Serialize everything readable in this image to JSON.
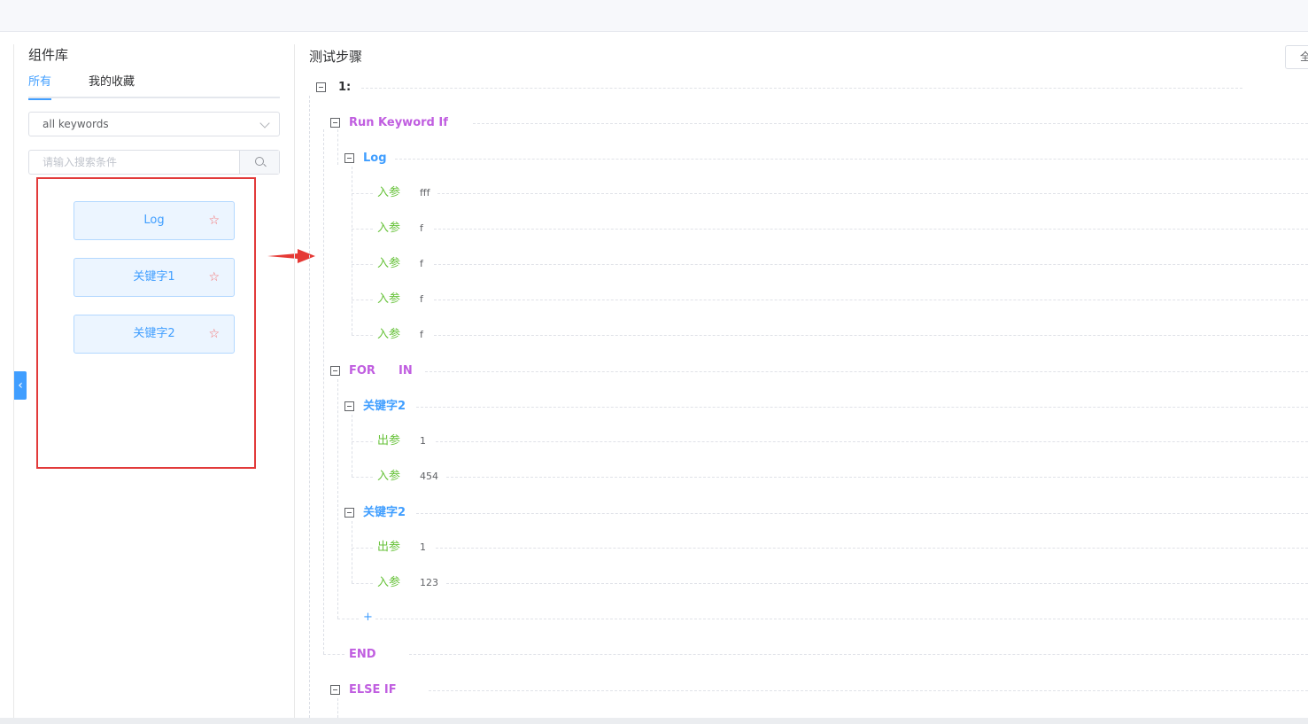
{
  "sidebar": {
    "title": "组件库",
    "tabs": [
      {
        "label": "所有"
      },
      {
        "label": "我的收藏"
      }
    ],
    "select_value": "all keywords",
    "search_placeholder": "请输入搜索条件",
    "keywords": [
      {
        "label": "Log"
      },
      {
        "label": "关键字1"
      },
      {
        "label": "关键字2"
      }
    ],
    "star_icon": "☆"
  },
  "steps": {
    "title": "测试步骤",
    "full_button": "全",
    "step_number": "1:",
    "run_keyword_if": "Run Keyword If",
    "log_label": "Log",
    "param_in": "入参",
    "param_out": "出参",
    "log_params": [
      "fff",
      "f",
      "f",
      "f",
      "f"
    ],
    "for_label": "FOR",
    "in_label": "IN",
    "kw_a": {
      "name": "关键字2",
      "out": "1",
      "in": "454"
    },
    "kw_b": {
      "name": "关键字2",
      "out": "1",
      "in": "123"
    },
    "plus": "+",
    "end_label": "END",
    "else_if_label": "ELSE IF"
  },
  "colors": {
    "accent": "#409eff",
    "control": "#c05ee0",
    "param": "#67c23a",
    "highlight_box": "#e23a3a"
  }
}
